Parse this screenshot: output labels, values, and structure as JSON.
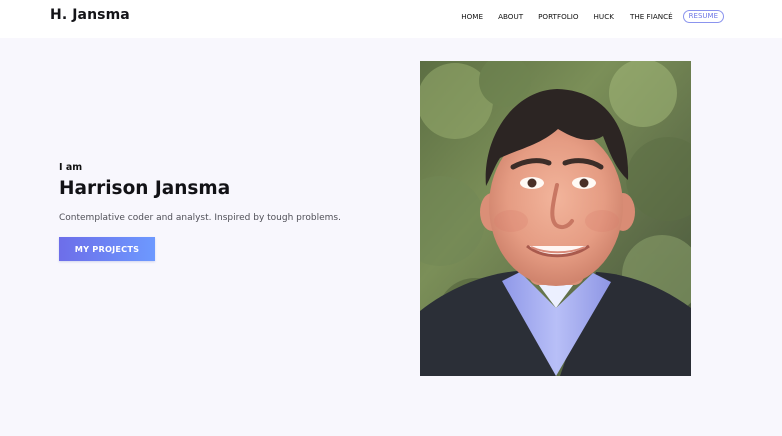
{
  "brand": {
    "title": "H. Jansma"
  },
  "nav": {
    "items": [
      {
        "label": "HOME"
      },
      {
        "label": "ABOUT"
      },
      {
        "label": "PORTFOLIO"
      },
      {
        "label": "HUCK"
      },
      {
        "label": "THE FIANCÉ"
      }
    ],
    "resume_label": "RESUME"
  },
  "hero": {
    "intro": "I am",
    "name": "Harrison Jansma",
    "tagline": "Contemplative coder and analyst. Inspired by tough problems.",
    "cta_label": "MY PROJECTS"
  },
  "colors": {
    "accent": "#6f78e6",
    "button_start": "#6d6ee9",
    "button_end": "#6d99ff",
    "background": "#f8f7fd"
  }
}
